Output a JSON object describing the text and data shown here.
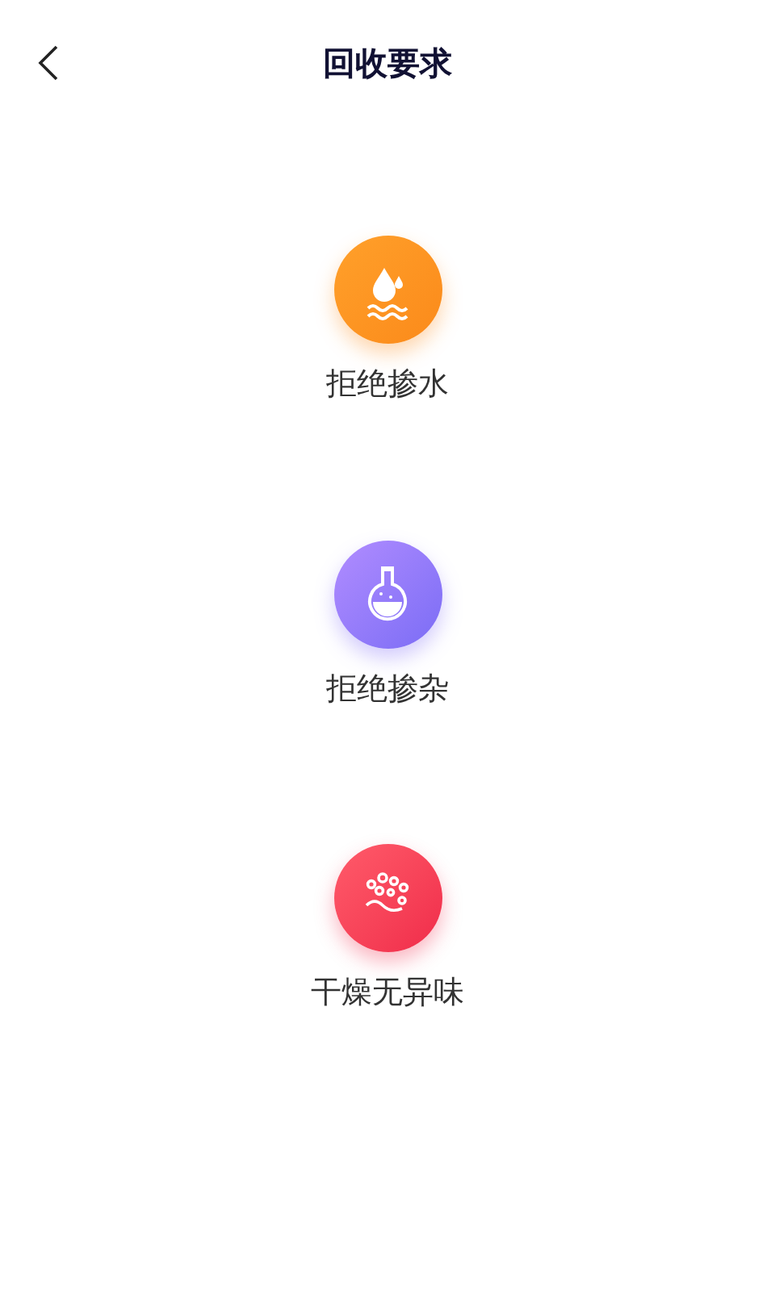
{
  "header": {
    "title": "回收要求"
  },
  "requirements": [
    {
      "kind": "water",
      "label": "拒绝掺水"
    },
    {
      "kind": "flask",
      "label": "拒绝掺杂"
    },
    {
      "kind": "odor",
      "label": "干燥无异味"
    }
  ]
}
